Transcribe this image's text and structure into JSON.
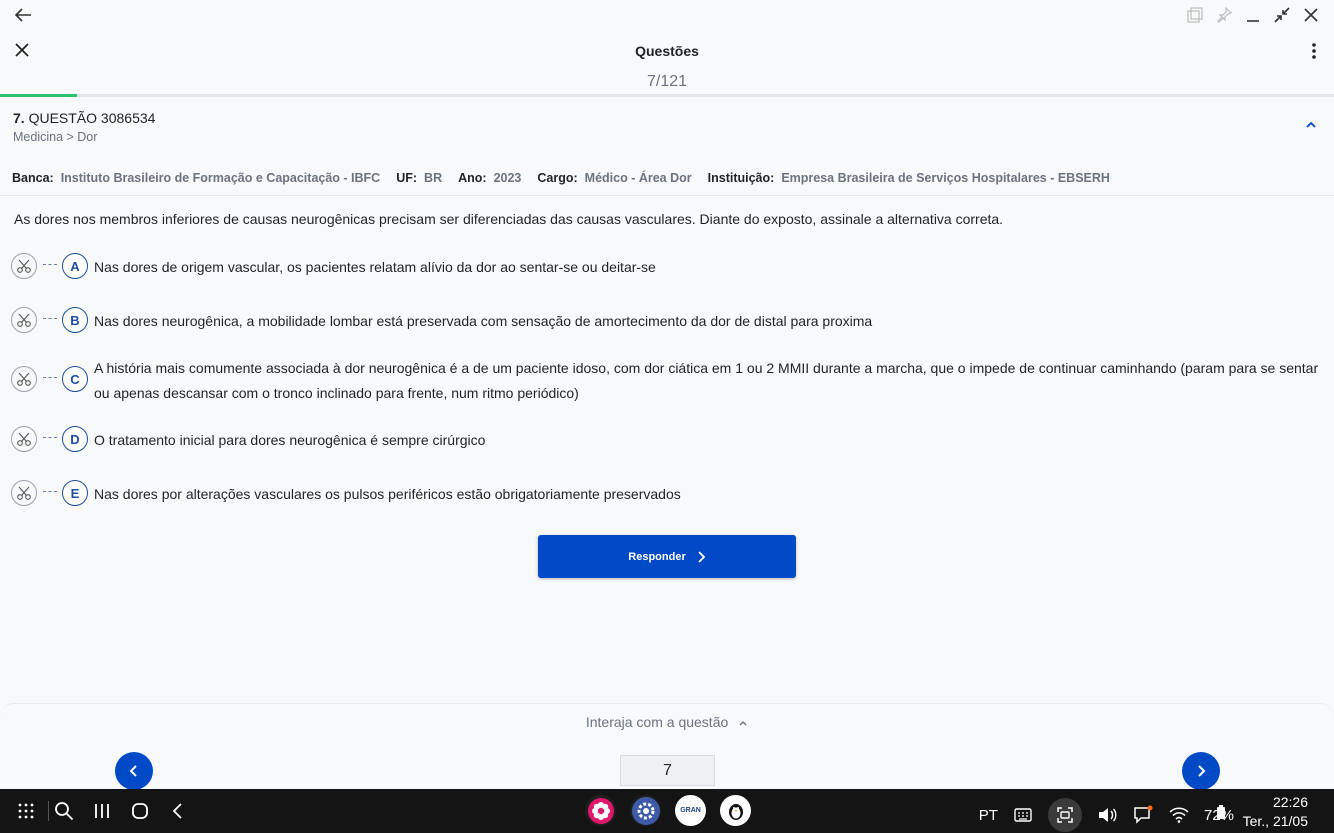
{
  "app": {
    "title": "Questões",
    "counter": "7/121",
    "progress_fraction": 0.058
  },
  "question": {
    "number": "7.",
    "label": "QUESTÃO 3086534",
    "subject": "Medicina > Dor",
    "meta": {
      "banca_key": "Banca:",
      "banca": "Instituto Brasileiro de Formação e Capacitação - IBFC",
      "uf_key": "UF:",
      "uf": "BR",
      "ano_key": "Ano:",
      "ano": "2023",
      "cargo_key": "Cargo:",
      "cargo": "Médico - Área Dor",
      "inst_key": "Instituição:",
      "inst": "Empresa Brasileira de Serviços Hospitalares - EBSERH"
    },
    "statement": "As dores nos membros inferiores de causas neurogênicas precisam ser diferenciadas das causas vasculares. Diante do exposto, assinale a alternativa correta.",
    "options": [
      {
        "letter": "A",
        "text": "Nas dores de origem vascular, os pacientes relatam alívio da dor ao sentar-se ou deitar-se"
      },
      {
        "letter": "B",
        "text": "Nas dores neurogênica, a mobilidade lombar está preservada com sensação de amortecimento da dor de distal para proxima"
      },
      {
        "letter": "C",
        "text": "A história mais comumente associada à dor neurogênica é a de um paciente idoso, com dor ciática em 1 ou 2 MMII durante a marcha, que o impede de continuar caminhando (param para se sentar ou apenas descansar com o tronco inclinado para frente, num ritmo periódico)"
      },
      {
        "letter": "D",
        "text": "O tratamento inicial para dores neurogênica é sempre cirúrgico"
      },
      {
        "letter": "E",
        "text": "Nas dores por alterações vasculares os pulsos periféricos estão obrigatoriamente preservados"
      }
    ],
    "submit_label": "Responder"
  },
  "bottom": {
    "interact_label": "Interaja com a questão",
    "page_value": "7"
  },
  "taskbar": {
    "language": "PT",
    "battery": "72%",
    "time": "22:26",
    "date": "Ter., 21/05",
    "app3_label": "GRAN"
  },
  "colors": {
    "primary": "#0049c7",
    "progress": "#2ec16f",
    "letter": "#1d4e9e"
  }
}
